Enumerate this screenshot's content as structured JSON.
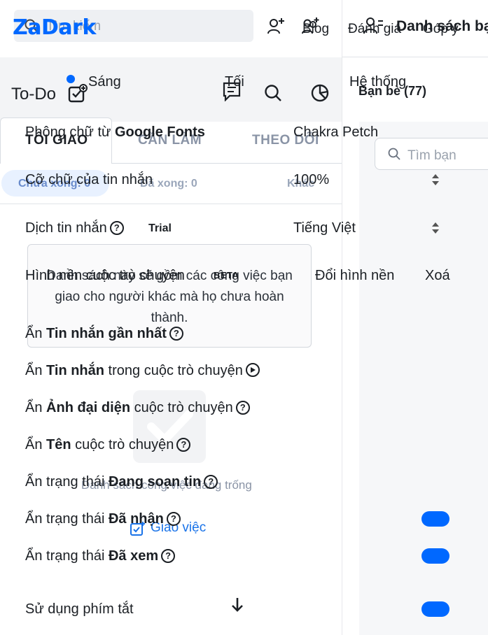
{
  "app": {
    "logo": "ZaDark"
  },
  "search": {
    "placeholder": "Tìm kiếm"
  },
  "top_links": {
    "blog": "Blog",
    "rate": "Đánh giá",
    "feedback": "Góp ý"
  },
  "right_pane": {
    "title": "Danh sách bạn",
    "friends_tab": "Bạn bè (77)",
    "friend_search_placeholder": "Tìm bạn"
  },
  "theme": {
    "light": "Sáng",
    "dark": "Tối",
    "system": "Hệ thống"
  },
  "todo": {
    "title": "To-Do",
    "tabs": [
      "TÔI GIAO",
      "CẦN LÀM",
      "THEO DÕI"
    ],
    "filters": {
      "undone": "Chưa xong: 0",
      "done": "Đã xong: 0",
      "other": "Khác"
    },
    "empty_description": "Danh sách này sẽ gồm các công việc bạn giao cho người khác mà họ chưa hoàn thành.",
    "empty_list": "Danh sách công việc đang trống",
    "assign_button": "Giao việc"
  },
  "settings": {
    "font_label_prefix": "Phông chữ từ ",
    "font_label_bold": "Google Fonts",
    "font_value": "Chakra Petch",
    "font_size_label": "Cỡ chữ của tin nhắn",
    "font_size_value": "100%",
    "translate_label": "Dịch tin nhắn",
    "translate_badge": "Trial",
    "translate_value": "Tiếng Việt",
    "wallpaper_label": "Hình nền cuộc trò chuyện",
    "wallpaper_badge": "BETA",
    "wallpaper_change": "Đổi hình nền",
    "wallpaper_delete": "Xoá",
    "hide_prefix": "Ẩn ",
    "status_prefix": "Ẩn trạng thái ",
    "hide_latest_bold": "Tin nhắn gần nhất",
    "hide_messages_bold": "Tin nhắn",
    "in_conversation": " trong cuộc trò chuyện",
    "hide_avatar_bold": "Ảnh đại diện",
    "hide_name_bold": "Tên",
    "conversation_suffix": " cuộc trò chuyện",
    "typing_bold": "Đang soạn tin",
    "received_bold": "Đã nhận",
    "seen_bold": "Đã xem",
    "shortcuts_label": "Sử dụng phím tắt",
    "help_glyph": "?"
  },
  "colors": {
    "accent": "#0068ff",
    "pill_bg": "#e8f1ff"
  }
}
